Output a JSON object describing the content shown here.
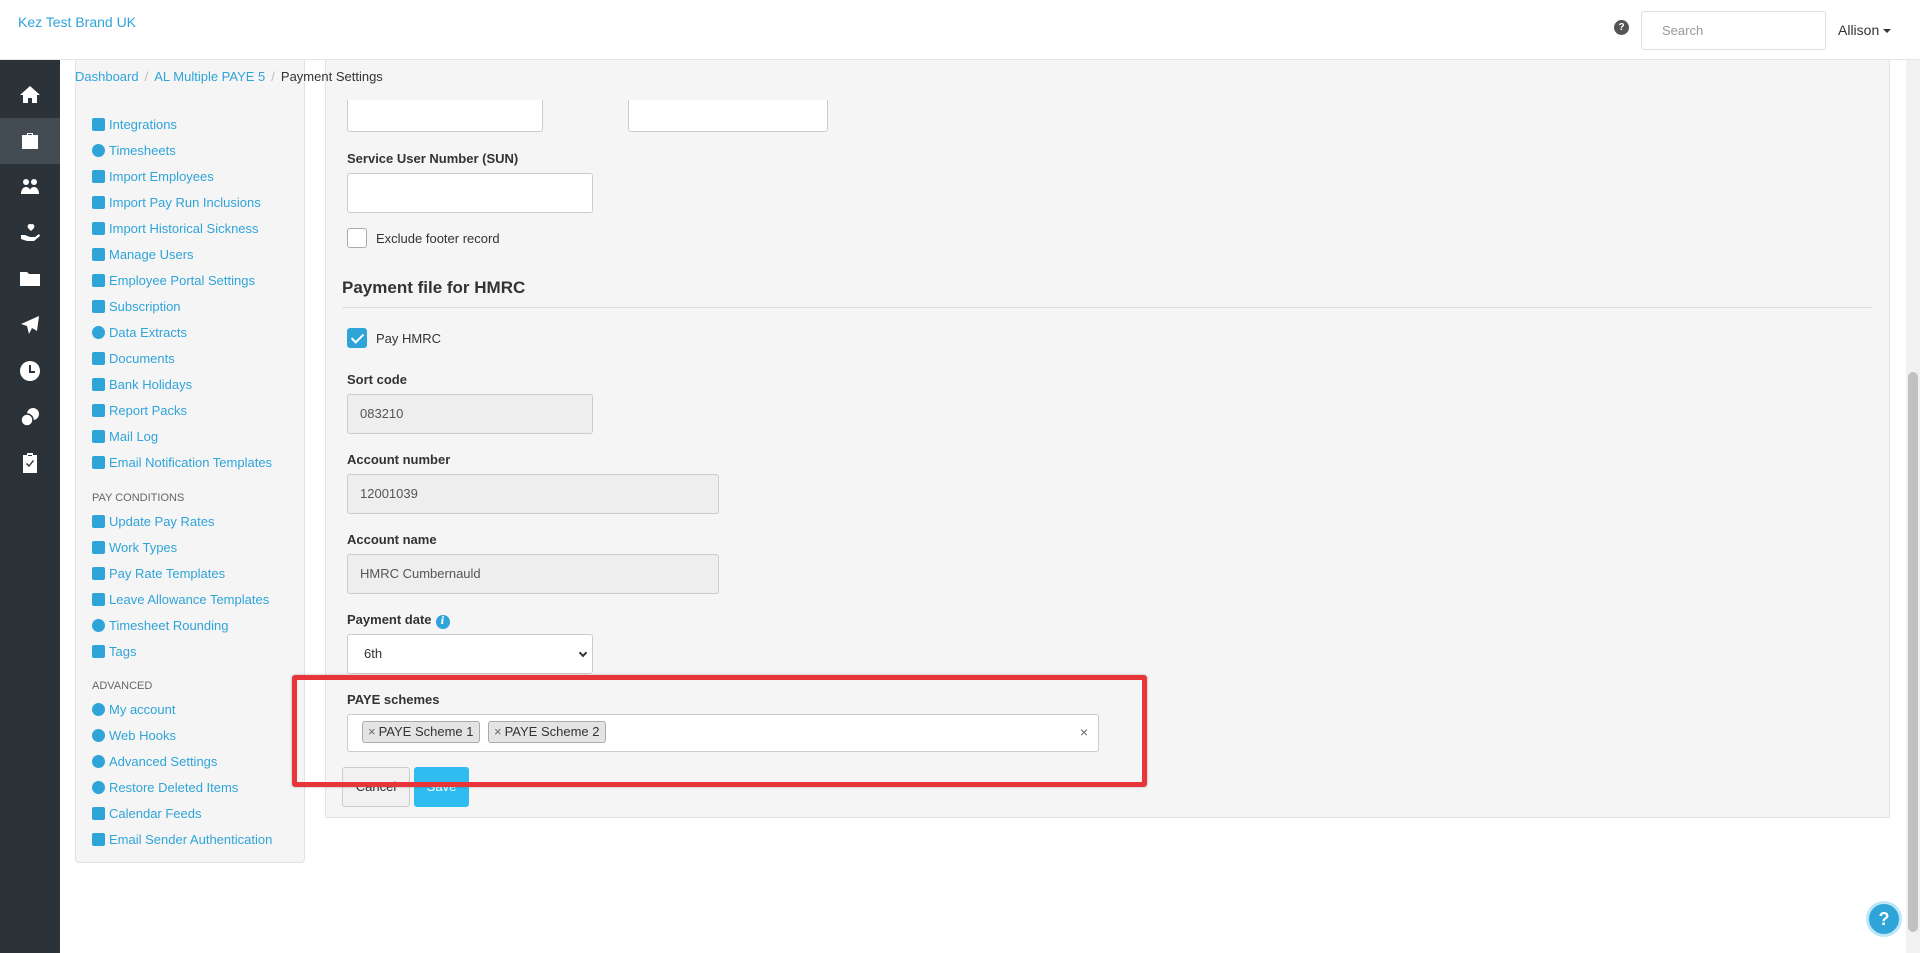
{
  "header": {
    "brand": "Kez Test Brand UK",
    "help_icon_glyph": "?",
    "search_placeholder": "Search",
    "user": "Allison"
  },
  "rail": {
    "icons": [
      "home-icon",
      "briefcase-icon",
      "people-icon",
      "hand-heart-icon",
      "folder-icon",
      "plane-icon",
      "clock-icon",
      "coins-icon",
      "clipboard-icon"
    ],
    "active_index": 1
  },
  "breadcrumb": {
    "items": [
      "Dashboard",
      "AL Multiple PAYE 5",
      "Payment Settings"
    ],
    "separator": "/"
  },
  "settings_nav": {
    "links_top": [
      {
        "label": "Integrations",
        "icon": "integrations-icon"
      },
      {
        "label": "Timesheets",
        "icon": "clock-icon"
      },
      {
        "label": "Import Employees",
        "icon": "people-icon"
      },
      {
        "label": "Import Pay Run Inclusions",
        "icon": "refresh-icon"
      },
      {
        "label": "Import Historical Sickness",
        "icon": "tag-icon"
      },
      {
        "label": "Manage Users",
        "icon": "lock-icon"
      },
      {
        "label": "Employee Portal Settings",
        "icon": "wand-icon"
      },
      {
        "label": "Subscription",
        "icon": "credit-card-icon"
      },
      {
        "label": "Data Extracts",
        "icon": "cloud-download-icon"
      },
      {
        "label": "Documents",
        "icon": "folder-icon"
      },
      {
        "label": "Bank Holidays",
        "icon": "calendar-icon"
      },
      {
        "label": "Report Packs",
        "icon": "folder-open-icon"
      },
      {
        "label": "Mail Log",
        "icon": "envelope-icon"
      },
      {
        "label": "Email Notification Templates",
        "icon": "envelope-open-icon"
      }
    ],
    "section_pay_conditions": "PAY CONDITIONS",
    "links_pay": [
      {
        "label": "Update Pay Rates",
        "icon": "hand-coins-icon"
      },
      {
        "label": "Work Types",
        "icon": "camera-icon"
      },
      {
        "label": "Pay Rate Templates",
        "icon": "money-icon"
      },
      {
        "label": "Leave Allowance Templates",
        "icon": "plane-icon"
      },
      {
        "label": "Timesheet Rounding",
        "icon": "clock-outline-icon"
      },
      {
        "label": "Tags",
        "icon": "tag-icon"
      }
    ],
    "section_advanced": "ADVANCED",
    "links_adv": [
      {
        "label": "My account",
        "icon": "user-circle-icon"
      },
      {
        "label": "Web Hooks",
        "icon": "cloud-icon"
      },
      {
        "label": "Advanced Settings",
        "icon": "gear-icon"
      },
      {
        "label": "Restore Deleted Items",
        "icon": "recycle-icon"
      },
      {
        "label": "Calendar Feeds",
        "icon": "calendar-icon"
      },
      {
        "label": "Email Sender Authentication",
        "icon": "envelope-icon"
      }
    ]
  },
  "form": {
    "sun_label": "Service User Number (SUN)",
    "sun_value": "",
    "exclude_footer_label": "Exclude footer record",
    "exclude_footer_checked": false,
    "hmrc_section_title": "Payment file for HMRC",
    "pay_hmrc_label": "Pay HMRC",
    "pay_hmrc_checked": true,
    "sort_code_label": "Sort code",
    "sort_code_value": "083210",
    "account_number_label": "Account number",
    "account_number_value": "12001039",
    "account_name_label": "Account name",
    "account_name_value": "HMRC Cumbernauld",
    "payment_date_label": "Payment date",
    "payment_date_value": "6th",
    "paye_label": "PAYE schemes",
    "paye_tags": [
      "PAYE Scheme 1",
      "PAYE Scheme 2"
    ],
    "tag_remove_glyph": "×",
    "clear_glyph": "×",
    "cancel_label": "Cancel",
    "save_label": "Save"
  },
  "help_float_glyph": "?",
  "colors": {
    "accent": "#2fa4d9",
    "rail_bg": "#2b3339",
    "highlight": "#e8353a",
    "save_button": "#2fbcf0"
  }
}
